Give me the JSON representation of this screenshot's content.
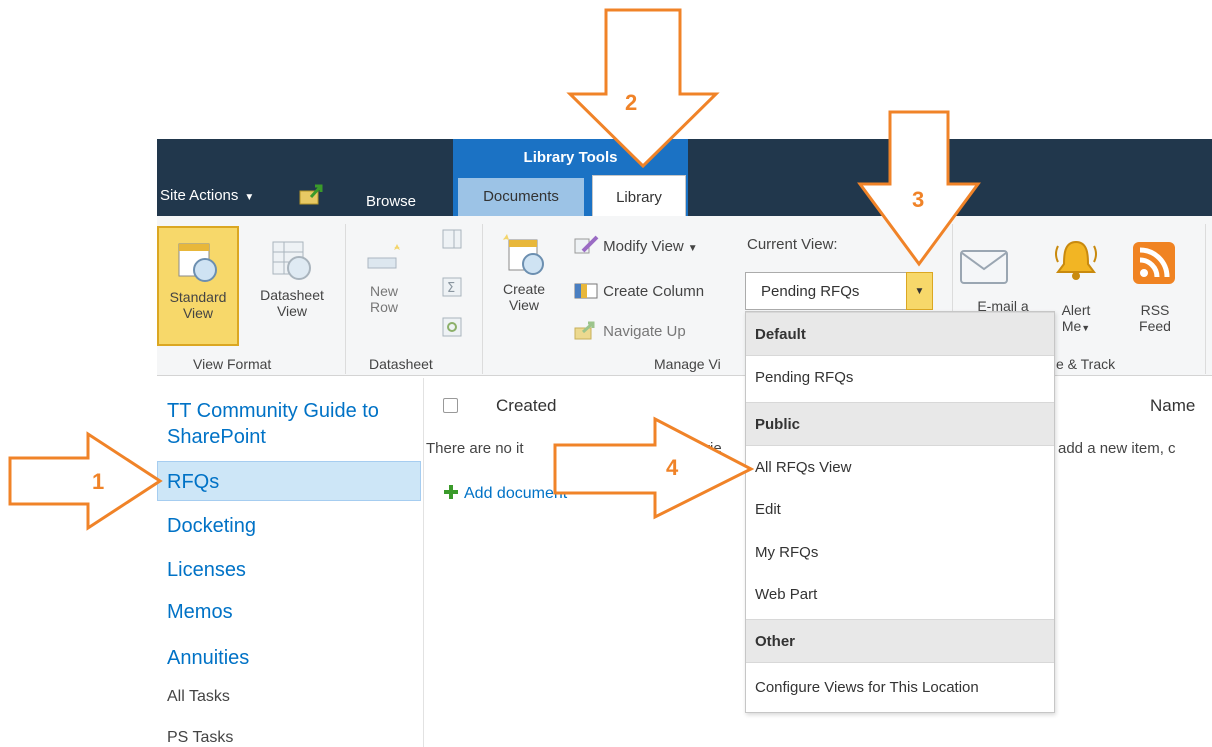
{
  "topbar": {
    "site_actions": "Site Actions",
    "browse": "Browse",
    "contextual_group": "Library Tools",
    "tabs": [
      "Documents",
      "Library"
    ]
  },
  "ribbon": {
    "view_format": {
      "standard_view": [
        "Standard",
        "View"
      ],
      "datasheet_view": [
        "Datasheet",
        "View"
      ],
      "label": "View Format"
    },
    "datasheet": {
      "new_row": [
        "New",
        "Row"
      ],
      "label": "Datasheet"
    },
    "manage_views": {
      "create_view": [
        "Create",
        "View"
      ],
      "modify_view": "Modify View",
      "create_column": "Create Column",
      "navigate_up": "Navigate Up",
      "current_view_label": "Current View:",
      "current_view_value": "Pending RFQs",
      "label_visible": "Manage Vi"
    },
    "share_track": {
      "email": "E-mail a",
      "alert_me": [
        "Alert",
        "Me"
      ],
      "rss": [
        "RSS",
        "Feed"
      ],
      "label_visible": "e & Track"
    }
  },
  "leftnav": {
    "site_title": "TT Community Guide to SharePoint",
    "items": [
      "RFQs",
      "Docketing",
      "Licenses",
      "Memos",
      "Annuities"
    ],
    "small_items": [
      "All Tasks",
      "PS Tasks"
    ]
  },
  "list": {
    "col_created": "Created",
    "col_name": "Name",
    "empty_message_left": "There are no it",
    "empty_message_mid": "e vie",
    "empty_message_right": "add a new item, c",
    "add_document": "Add document"
  },
  "dropdown": {
    "groups": [
      {
        "header": "Default",
        "items": [
          "Pending RFQs"
        ]
      },
      {
        "header": "Public",
        "items": [
          "All RFQs View",
          "Edit",
          "My RFQs",
          "Web Part"
        ]
      },
      {
        "header": "Other",
        "items": [
          "Configure Views for This Location"
        ]
      }
    ]
  },
  "annotations": {
    "arrow_color": "#f08328",
    "labels": [
      "1",
      "2",
      "3",
      "4"
    ]
  },
  "colors": {
    "topbar": "#21374c",
    "contextual_tab": "#1b72c4",
    "selected_button": "#f7d86a",
    "link": "#0072c6"
  }
}
